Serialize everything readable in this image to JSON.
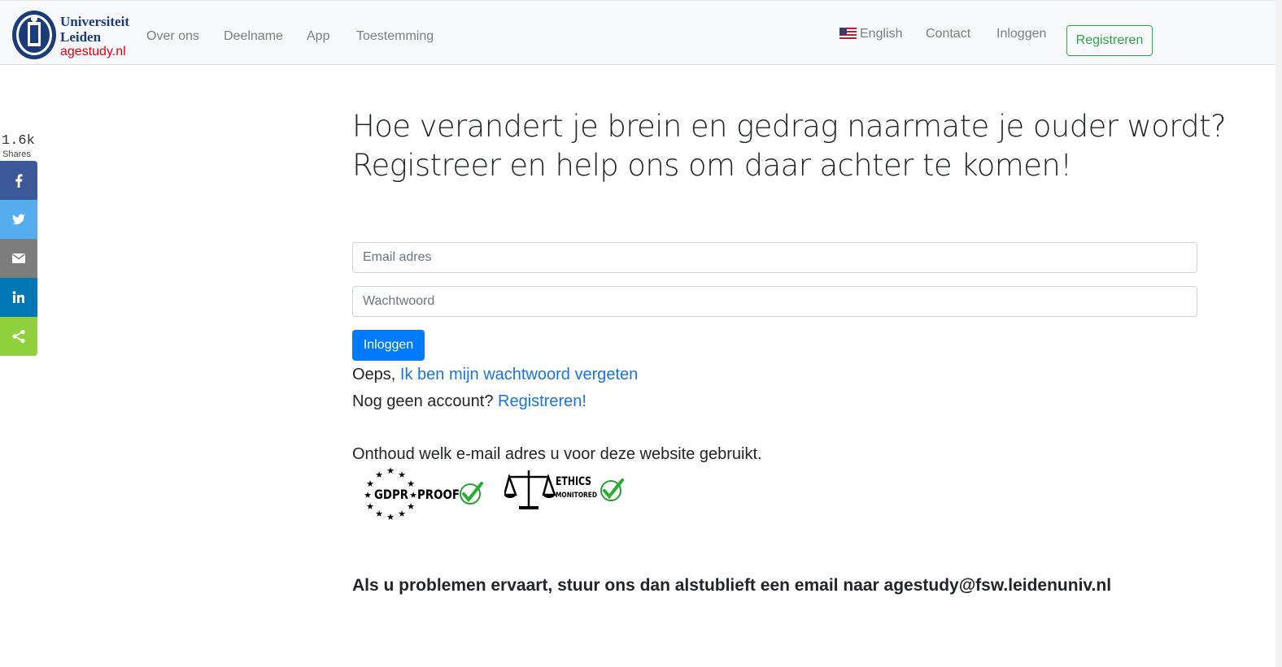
{
  "brand": {
    "line1": "Universiteit",
    "line2": "Leiden",
    "site": "agestudy.nl"
  },
  "nav": {
    "left": [
      "Over ons",
      "Deelname",
      "App",
      "Toestemming"
    ],
    "language": "English",
    "contact": "Contact",
    "login": "Inloggen",
    "register": "Registreren"
  },
  "share": {
    "count": "1.6k",
    "label": "Shares",
    "buttons": [
      {
        "name": "facebook",
        "color": "#3b5998"
      },
      {
        "name": "twitter",
        "color": "#55acee"
      },
      {
        "name": "email",
        "color": "#7d7d7d"
      },
      {
        "name": "linkedin",
        "color": "#0077b5"
      },
      {
        "name": "share",
        "color": "#8ed13d"
      }
    ]
  },
  "main": {
    "heading_line1": "Hoe verandert je brein en gedrag naarmate je ouder wordt?",
    "heading_line2": "Registreer en help ons om daar achter te komen!",
    "email_placeholder": "Email adres",
    "password_placeholder": "Wachtwoord",
    "login_button": "Inloggen",
    "forgot_prefix": "Oeps, ",
    "forgot_link": "Ik ben mijn wachtwoord vergeten",
    "no_account_prefix": "Nog geen account? ",
    "register_link": "Registreren!",
    "remember_note": "Onthoud welk e-mail adres u voor deze website gebruikt.",
    "gdpr_left": "GDPR",
    "gdpr_right": "PROOF",
    "ethics_top": "ETHICS",
    "ethics_bottom": "MONITORED",
    "problems_note": "Als u problemen ervaart, stuur ons dan alstublieft een email naar agestudy@fsw.leidenuniv.nl"
  },
  "colors": {
    "primary": "#007bff",
    "success": "#28a745",
    "link": "#1a73e8",
    "brand_blue": "#1a3c7a",
    "brand_red": "#e3000f"
  }
}
